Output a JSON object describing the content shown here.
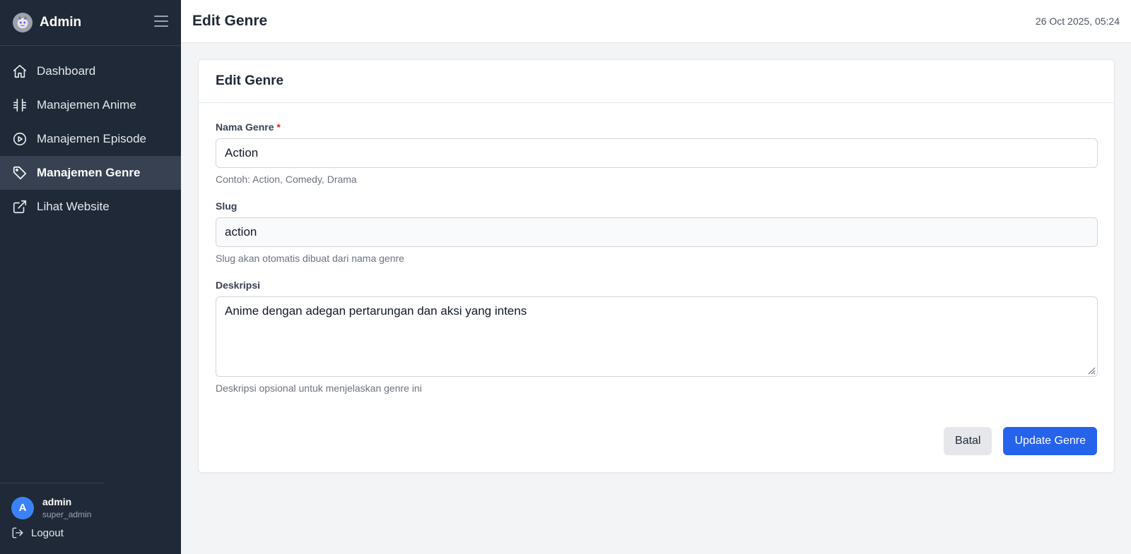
{
  "sidebar": {
    "brand": "Admin",
    "items": [
      {
        "label": "Dashboard",
        "icon": "home-icon"
      },
      {
        "label": "Manajemen Anime",
        "icon": "film-icon"
      },
      {
        "label": "Manajemen Episode",
        "icon": "play-circle-icon"
      },
      {
        "label": "Manajemen Genre",
        "icon": "tag-icon",
        "active": true
      },
      {
        "label": "Lihat Website",
        "icon": "external-link-icon"
      }
    ],
    "user": {
      "initial": "A",
      "name": "admin",
      "role": "super_admin"
    },
    "logout_label": "Logout"
  },
  "header": {
    "title": "Edit Genre",
    "datetime": "26 Oct 2025, 05:24"
  },
  "card": {
    "title": "Edit Genre",
    "fields": {
      "name": {
        "label": "Nama Genre",
        "required_mark": "*",
        "value": "Action",
        "help": "Contoh: Action, Comedy, Drama"
      },
      "slug": {
        "label": "Slug",
        "value": "action",
        "help": "Slug akan otomatis dibuat dari nama genre"
      },
      "description": {
        "label": "Deskripsi",
        "value": "Anime dengan adegan pertarungan dan aksi yang intens",
        "help": "Deskripsi opsional untuk menjelaskan genre ini"
      }
    },
    "actions": {
      "cancel": "Batal",
      "submit": "Update Genre"
    }
  },
  "colors": {
    "sidebar_bg": "#1f2937",
    "active_item_bg": "#374151",
    "primary": "#2563eb",
    "avatar": "#3b82f6",
    "required": "#dc2626"
  }
}
